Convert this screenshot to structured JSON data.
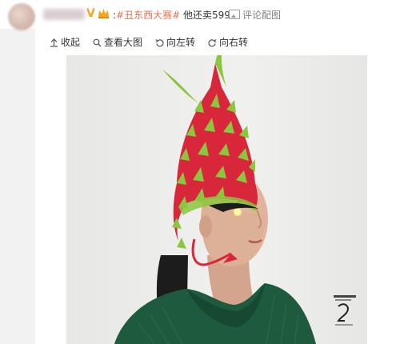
{
  "post": {
    "topic": "#丑东西大赛#",
    "text": "他还卖599",
    "comment_image_label": "评论配图"
  },
  "toolbar": {
    "collapse_label": "收起",
    "view_large_label": "查看大图",
    "rotate_left_label": "向左转",
    "rotate_right_label": "向右转"
  },
  "icons": {
    "collapse": "arrow-up-icon",
    "view_large": "magnifier-icon",
    "rotate_left": "rotate-left-icon",
    "rotate_right": "rotate-right-icon",
    "comment_image": "picture-icon",
    "verified": "verified-v-icon",
    "member": "crown-icon"
  },
  "colors": {
    "topic": "#eb7350",
    "verified": "#f7a31c",
    "hat_red": "#d8263a",
    "hat_green": "#8cc63f",
    "sweater": "#1e5a3d"
  }
}
